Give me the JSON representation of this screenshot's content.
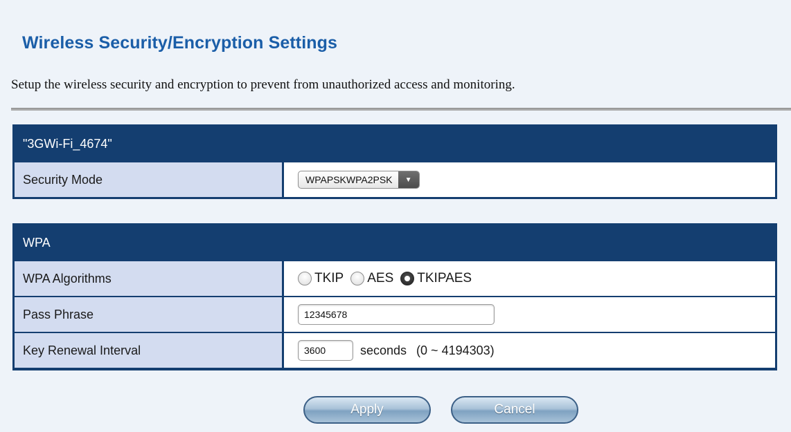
{
  "page": {
    "title": "Wireless Security/Encryption Settings",
    "description": "Setup the wireless security and encryption to prevent from unauthorized access and monitoring."
  },
  "ssid_section": {
    "header": "\"3GWi-Fi_4674\"",
    "security_mode": {
      "label": "Security Mode",
      "selected": "WPAPSKWPA2PSK",
      "arrow": "▼"
    }
  },
  "wpa_section": {
    "header": "WPA",
    "algorithms": {
      "label": "WPA Algorithms",
      "options": [
        {
          "label": "TKIP",
          "checked": false
        },
        {
          "label": "AES",
          "checked": false
        },
        {
          "label": "TKIPAES",
          "checked": true
        }
      ]
    },
    "pass_phrase": {
      "label": "Pass Phrase",
      "value": "12345678"
    },
    "key_renewal": {
      "label": "Key Renewal Interval",
      "value": "3600",
      "unit": "seconds",
      "range": "(0 ~ 4194303)"
    }
  },
  "buttons": {
    "apply": "Apply",
    "cancel": "Cancel"
  },
  "colors": {
    "title": "#1b5ea8",
    "table_header": "#143e70",
    "label_cell": "#d3dcf0"
  }
}
